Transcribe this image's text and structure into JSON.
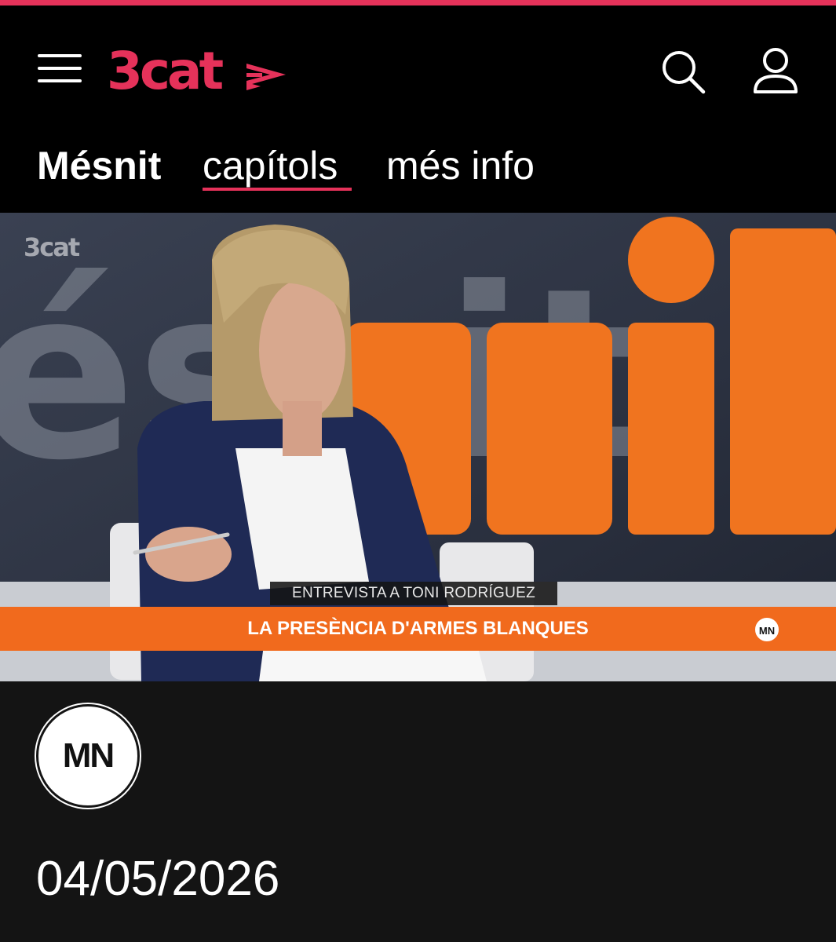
{
  "header": {
    "brand": "3cat",
    "menu_icon": "hamburger-menu-icon",
    "search_icon": "search-icon",
    "user_icon": "user-profile-icon",
    "accent_color": "#e5325a"
  },
  "tabs": [
    {
      "label": "Mésnit",
      "active": false
    },
    {
      "label": "capítols",
      "active": true
    },
    {
      "label": "més info",
      "active": false
    }
  ],
  "video": {
    "watermark": "3cat",
    "backdrop_text": "ésnit",
    "lower_third_name": "ENTREVISTA A TONI RODRÍGUEZ",
    "lower_third_title": "LA PRESÈNCIA D'ARMES BLANQUES",
    "badge": "MN",
    "bar_color": "#f16a1d"
  },
  "program": {
    "logo_text": "MN",
    "date": "04/05/2026"
  }
}
